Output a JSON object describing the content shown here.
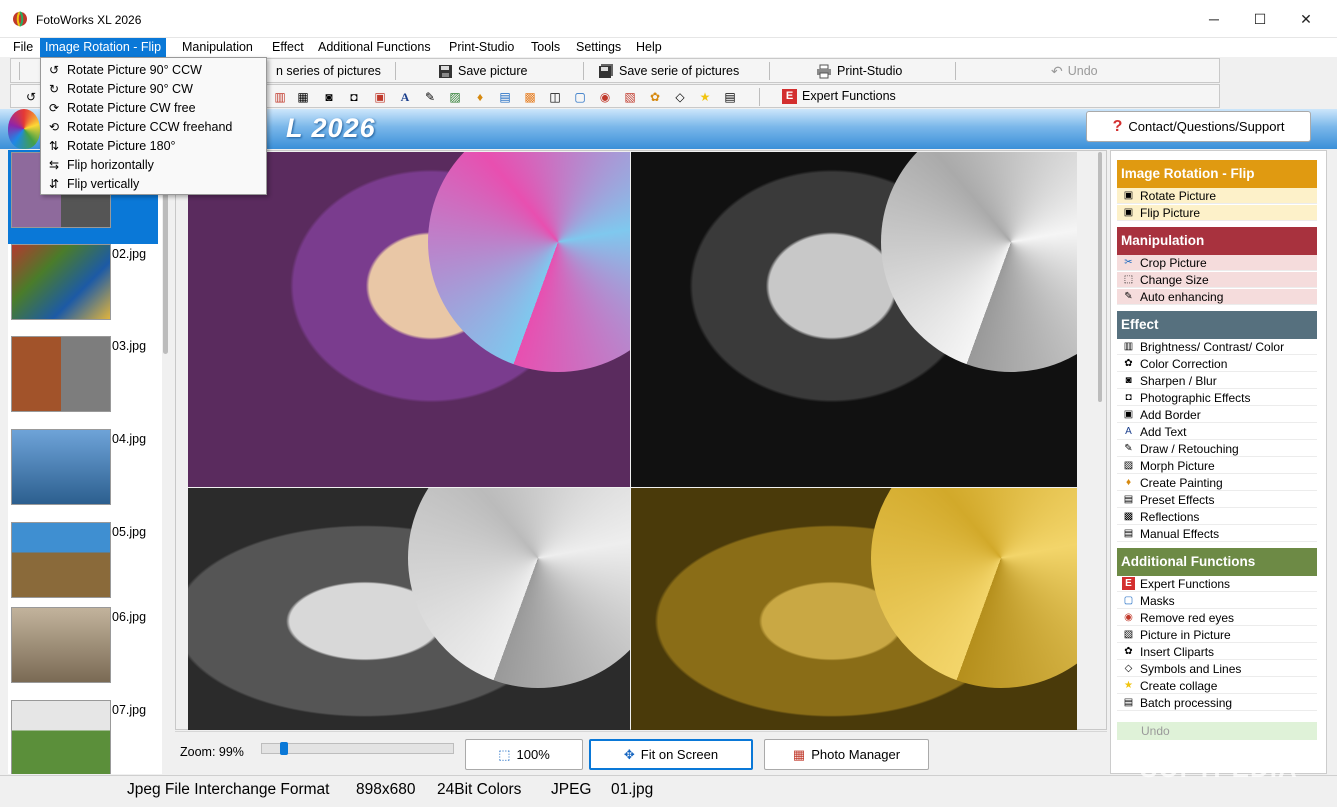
{
  "window": {
    "title": "FotoWorks XL 2026",
    "min_glyph": "─",
    "max_glyph": "☐",
    "close_glyph": "✕"
  },
  "menubar": {
    "items": [
      "File",
      "Image Rotation - Flip",
      "Manipulation",
      "Effect",
      "Additional Functions",
      "Print-Studio",
      "Tools",
      "Settings",
      "Help"
    ]
  },
  "toolbar1": {
    "open_series": "n series of pictures",
    "save_picture": "Save picture",
    "save_series": "Save serie of pictures",
    "print_studio": "Print-Studio",
    "undo": "Undo"
  },
  "toolbar2": {
    "expert_functions": "Expert Functions",
    "expert_badge": "E"
  },
  "banner": {
    "year": "2026",
    "logo_fragment": "L",
    "contact_button": "Contact/Questions/Support",
    "contact_icon": "?"
  },
  "dropdown": {
    "items": [
      "Rotate Picture 90° CCW",
      "Rotate Picture 90° CW",
      "Rotate Picture CW free",
      "Rotate Picture CCW freehand",
      "Rotate Picture 180°",
      "Flip horizontally",
      "Flip vertically"
    ]
  },
  "thumbnails": [
    {
      "name": "",
      "selected": true
    },
    {
      "name": "02.jpg"
    },
    {
      "name": "03.jpg"
    },
    {
      "name": "04.jpg"
    },
    {
      "name": "05.jpg"
    },
    {
      "name": "06.jpg"
    },
    {
      "name": "07.jpg"
    }
  ],
  "zoom": {
    "label": "Zoom: 99%",
    "level_percent": 99,
    "btn_100": "100%",
    "btn_fit": "Fit on Screen",
    "btn_manager": "Photo Manager"
  },
  "right_panel": {
    "sections": [
      {
        "title": "Image Rotation - Flip",
        "color": "#e09a11",
        "items_bg": "#fdf1c9",
        "items": [
          "Rotate Picture",
          "Flip Picture"
        ]
      },
      {
        "title": "Manipulation",
        "color": "#a8323e",
        "items_bg": "#f5dcdc",
        "items": [
          "Crop Picture",
          "Change Size",
          "Auto enhancing"
        ]
      },
      {
        "title": "Effect",
        "color": "#56707e",
        "items_bg": "#ffffff",
        "items": [
          "Brightness/ Contrast/ Color",
          "Color Correction",
          "Sharpen / Blur",
          "Photographic Effects",
          "Add Border",
          "Add Text",
          "Draw / Retouching",
          "Morph Picture",
          "Create Painting",
          "Preset Effects",
          "Reflections",
          "Manual Effects"
        ]
      },
      {
        "title": "Additional Functions",
        "color": "#6d8a45",
        "items_bg": "#ffffff",
        "items": [
          "Expert Functions",
          "Masks",
          "Remove red eyes",
          "Picture in Picture",
          "Insert Cliparts",
          "Symbols and Lines",
          "Create collage",
          "Batch processing"
        ]
      }
    ],
    "undo": "Undo"
  },
  "statusbar": {
    "format": "Jpeg File Interchange Format",
    "dimensions": "898x680",
    "colors": "24Bit Colors",
    "type": "JPEG",
    "file": "01.jpg"
  },
  "watermark": "SOFTPEDIA",
  "colors": {
    "accent": "#0a78d7",
    "banner": "#3a8fd8"
  }
}
